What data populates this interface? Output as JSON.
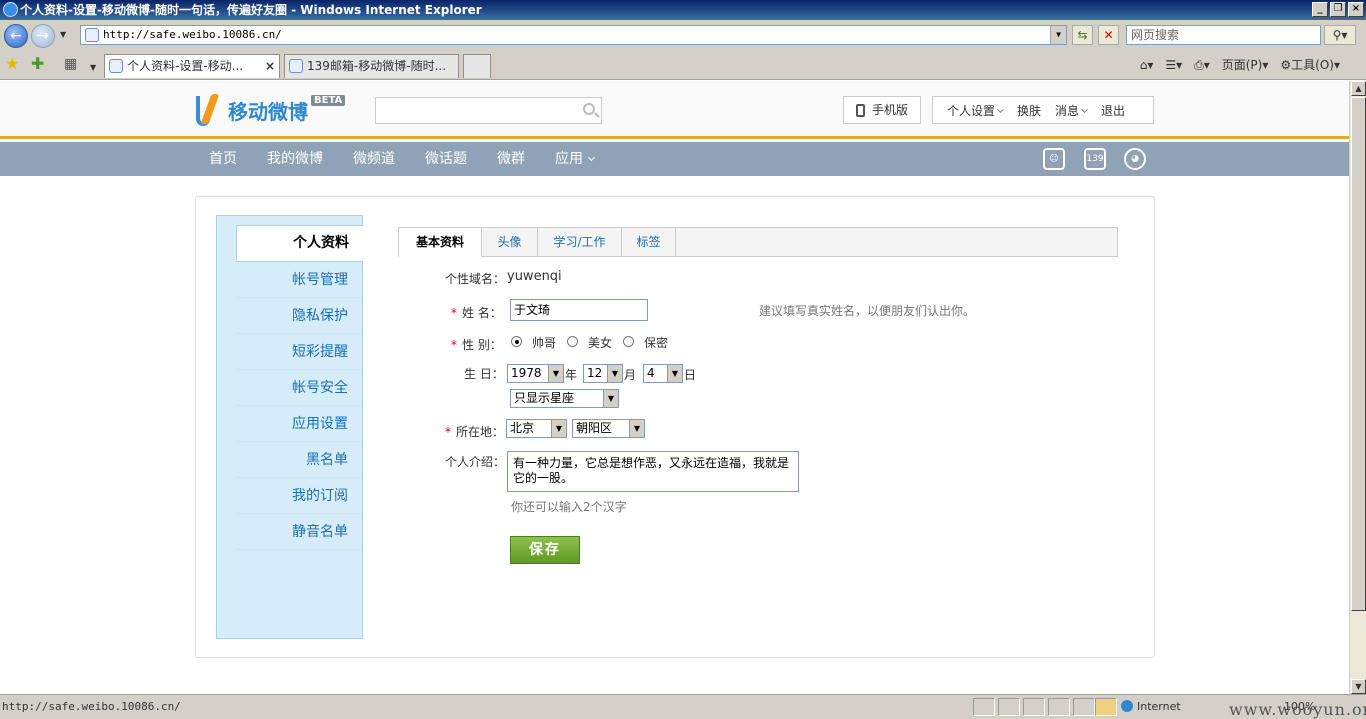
{
  "browser": {
    "window_title": "个人资料-设置-移动微博-随时一句话，传遍好友圈 - Windows Internet Explorer",
    "address": "http://safe.weibo.10086.cn/",
    "search_placeholder": "网页搜索",
    "tabs": [
      {
        "label": "个人资料-设置-移动..."
      },
      {
        "label": "139邮箱-移动微博-随时..."
      }
    ],
    "commands": {
      "page": "页面(P)",
      "tools": "工具(O)"
    },
    "status_url": "http://safe.weibo.10086.cn/",
    "zone": "Internet",
    "zoom": "100%",
    "watermark": "www.wooyun.org"
  },
  "site": {
    "logo_text": "移动微博",
    "logo_badge": "BETA",
    "mobile_label": "手机版",
    "user_menu": {
      "settings": "个人设置",
      "skin": "换肤",
      "messages": "消息",
      "logout": "退出"
    },
    "nav": [
      "首页",
      "我的微博",
      "微频道",
      "微话题",
      "微群",
      "应用"
    ],
    "nav_icon_mail": "139",
    "colors": {
      "accent": "#e5a72a",
      "nav_bg": "#8fa2b6",
      "save": "#6aa62a"
    }
  },
  "sidebar": {
    "active": "个人资料",
    "items": [
      "帐号管理",
      "隐私保护",
      "短彩提醒",
      "帐号安全",
      "应用设置",
      "黑名单",
      "我的订阅",
      "静音名单"
    ]
  },
  "profile_tabs": [
    "基本资料",
    "头像",
    "学习/工作",
    "标签"
  ],
  "form": {
    "domain_label": "个性域名：",
    "domain_value": "yuwenqi",
    "name_label": "姓  名：",
    "name_value": "于文琦",
    "name_hint": "建议填写真实姓名，以便朋友们认出你。",
    "gender_label": "性  别：",
    "gender_options": [
      "帅哥",
      "美女",
      "保密"
    ],
    "gender_selected": "帅哥",
    "birthday_label": "生  日：",
    "birth_year": "1978",
    "birth_month": "12",
    "birth_day": "4",
    "unit_year": "年",
    "unit_month": "月",
    "unit_day": "日",
    "birthday_privacy": "只显示星座",
    "location_label": "所在地：",
    "province": "北京",
    "district": "朝阳区",
    "intro_label": "个人介绍：",
    "intro_value": "有一种力量，它总是想作恶，又永远在造福，我就是它的一股。",
    "intro_hint": "你还可以输入2个汉字",
    "save_label": "保存"
  }
}
